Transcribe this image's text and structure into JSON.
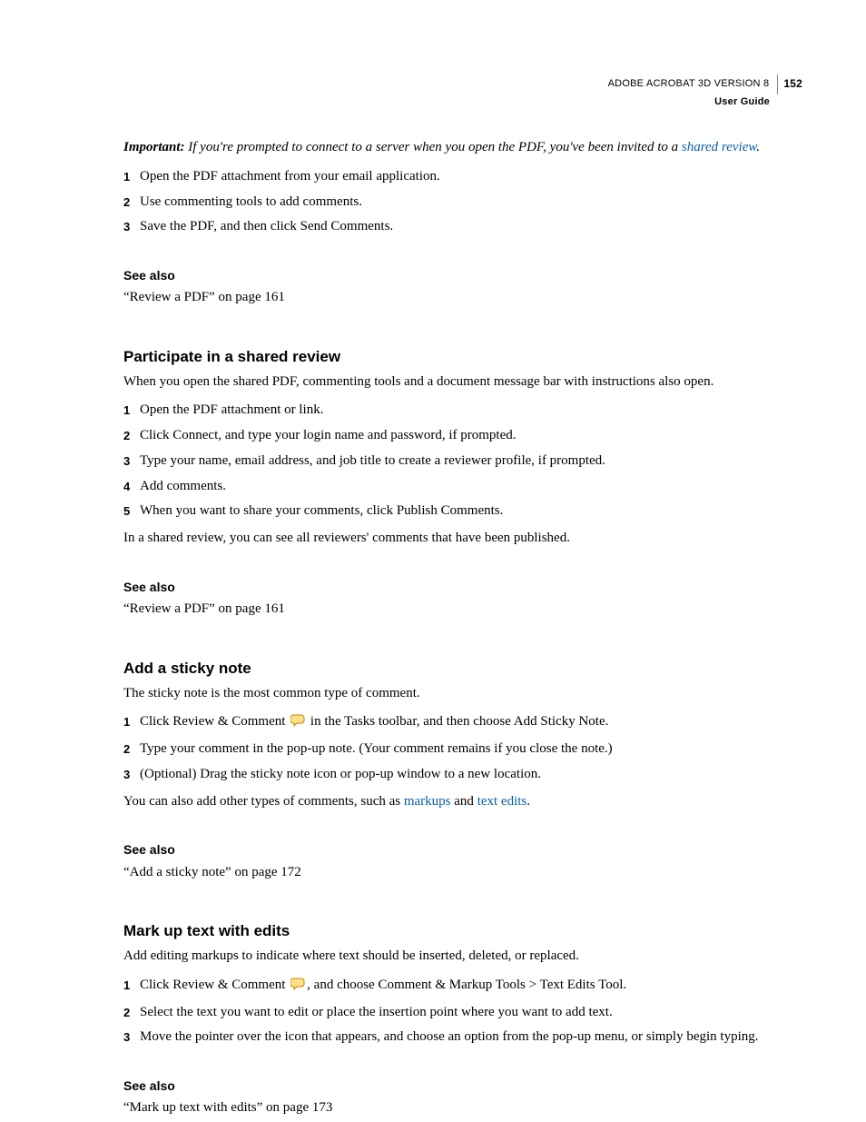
{
  "header": {
    "product": "ADOBE ACROBAT 3D VERSION 8",
    "page": "152",
    "subtitle": "User Guide"
  },
  "important": {
    "label": "Important:",
    "before": " If you're prompted to connect to a server when you open the PDF, you've been invited to a ",
    "link": "shared review",
    "after": "."
  },
  "introSteps": [
    "Open the PDF attachment from your email application.",
    "Use commenting tools to add comments.",
    "Save the PDF, and then click Send Comments."
  ],
  "sa1": {
    "title": "See also",
    "ref": "“Review a PDF” on page 161"
  },
  "shared": {
    "title": "Participate in a shared review",
    "intro": "When you open the shared PDF, commenting tools and a document message bar with instructions also open.",
    "steps": [
      "Open the PDF attachment or link.",
      "Click Connect, and type your login name and password, if prompted.",
      "Type your name, email address, and job title to create a reviewer profile, if prompted.",
      "Add comments.",
      "When you want to share your comments, click Publish Comments."
    ],
    "trail": "In a shared review, you can see all reviewers' comments that have been published."
  },
  "sa2": {
    "title": "See also",
    "ref": "“Review a PDF” on page 161"
  },
  "sticky": {
    "title": "Add a sticky note",
    "intro": "The sticky note is the most common type of comment.",
    "step1a": "Click Review & Comment ",
    "step1b": " in the Tasks toolbar, and then choose Add Sticky Note.",
    "step2": "Type your comment in the pop-up note. (Your comment remains if you close the note.)",
    "step3": "(Optional) Drag the sticky note icon or pop-up window to a new location.",
    "trailA": "You can also add other types of comments, such as ",
    "link1": "markups",
    "mid": " and ",
    "link2": "text edits",
    "trailB": "."
  },
  "sa3": {
    "title": "See also",
    "ref": "“Add a sticky note” on page 172"
  },
  "markup": {
    "title": "Mark up text with edits",
    "intro": "Add editing markups to indicate where text should be inserted, deleted, or replaced.",
    "step1a": "Click Review & Comment ",
    "step1b": ", and choose Comment & Markup Tools > Text Edits Tool.",
    "step2": "Select the text you want to edit or place the insertion point where you want to add text.",
    "step3": "Move the pointer over the icon that appears, and choose an option from the pop-up menu, or simply begin typing."
  },
  "sa4": {
    "title": "See also",
    "ref": "“Mark up text with edits” on page 173"
  },
  "nums": {
    "1": "1",
    "2": "2",
    "3": "3",
    "4": "4",
    "5": "5"
  }
}
